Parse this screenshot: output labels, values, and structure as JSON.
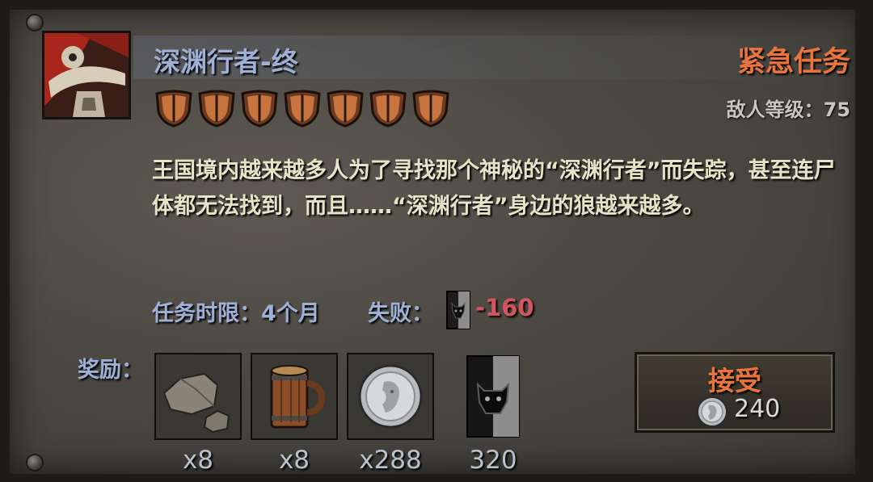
{
  "quest": {
    "title": "深渊行者-终",
    "type_label": "紧急任务",
    "enemy_level_text": "敌人等级：75",
    "difficulty_shields": 7,
    "description": "王国境内越来越多人为了寻找那个神秘的“深渊行者”而失踪，甚至连尸体都无法找到，而且……“深渊行者”身边的狼越来越多。",
    "time_limit_text": "任务时限：4个月",
    "failure_label": "失败：",
    "failure_penalty": "-160"
  },
  "rewards": {
    "label": "奖励：",
    "items": [
      {
        "icon": "stone-icon",
        "count": "x8"
      },
      {
        "icon": "wooden-mug-icon",
        "count": "x8"
      },
      {
        "icon": "silver-coin-icon",
        "count": "x288"
      },
      {
        "icon": "reputation-banner-icon",
        "count": "320"
      }
    ]
  },
  "accept": {
    "label": "接受",
    "cost": "240",
    "cost_icon": "silver-coin-icon"
  },
  "colors": {
    "title": "#9fb0d6",
    "urgent": "#e9743c",
    "description": "#e6e4c6",
    "penalty": "#d45560"
  }
}
